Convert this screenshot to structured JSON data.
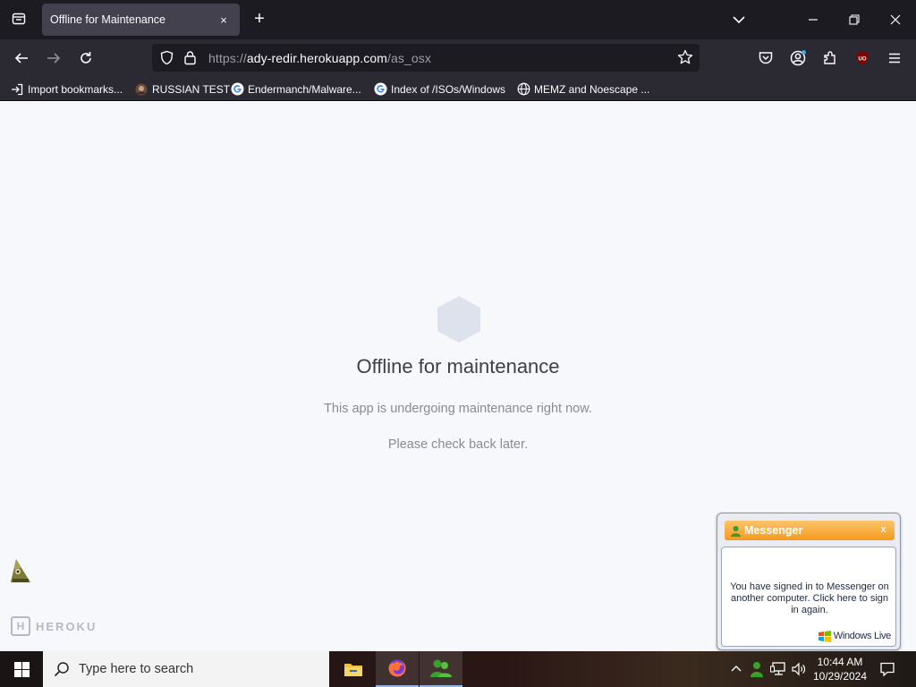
{
  "browser": {
    "tab": {
      "title": "Offline for Maintenance",
      "close": "×"
    },
    "new_tab": "+",
    "url": {
      "scheme": "https://",
      "host": "ady-redir.herokuapp.com",
      "path": "/as_osx"
    },
    "bookmarks": [
      {
        "label": "Import bookmarks...",
        "icon": "import-icon"
      },
      {
        "label": "RUSSIAN TEST",
        "icon": "favicon-icon"
      },
      {
        "label": "Endermanch/Malware...",
        "icon": "google-icon"
      },
      {
        "label": "Index of /ISOs/Windows",
        "icon": "google-icon"
      },
      {
        "label": "MEMZ and Noescape ...",
        "icon": "globe-icon"
      }
    ]
  },
  "page": {
    "title": "Offline for maintenance",
    "message1": "This app is undergoing maintenance right now.",
    "message2": "Please check back later.",
    "brand": "HEROKU",
    "brand_logo_letter": "H"
  },
  "messenger": {
    "title": "Messenger",
    "close": "x",
    "text": "You have signed in to Messenger on another computer. Click here to sign in again.",
    "brand": "Windows Live"
  },
  "taskbar": {
    "search_placeholder": "Type here to search",
    "time": "10:44 AM",
    "date": "10/29/2024"
  },
  "colors": {
    "page_bg": "#f7f8fb",
    "chrome_dark": "#1c1b22",
    "toolbar": "#2b2a33",
    "messenger_orange": "#f59a1e"
  }
}
